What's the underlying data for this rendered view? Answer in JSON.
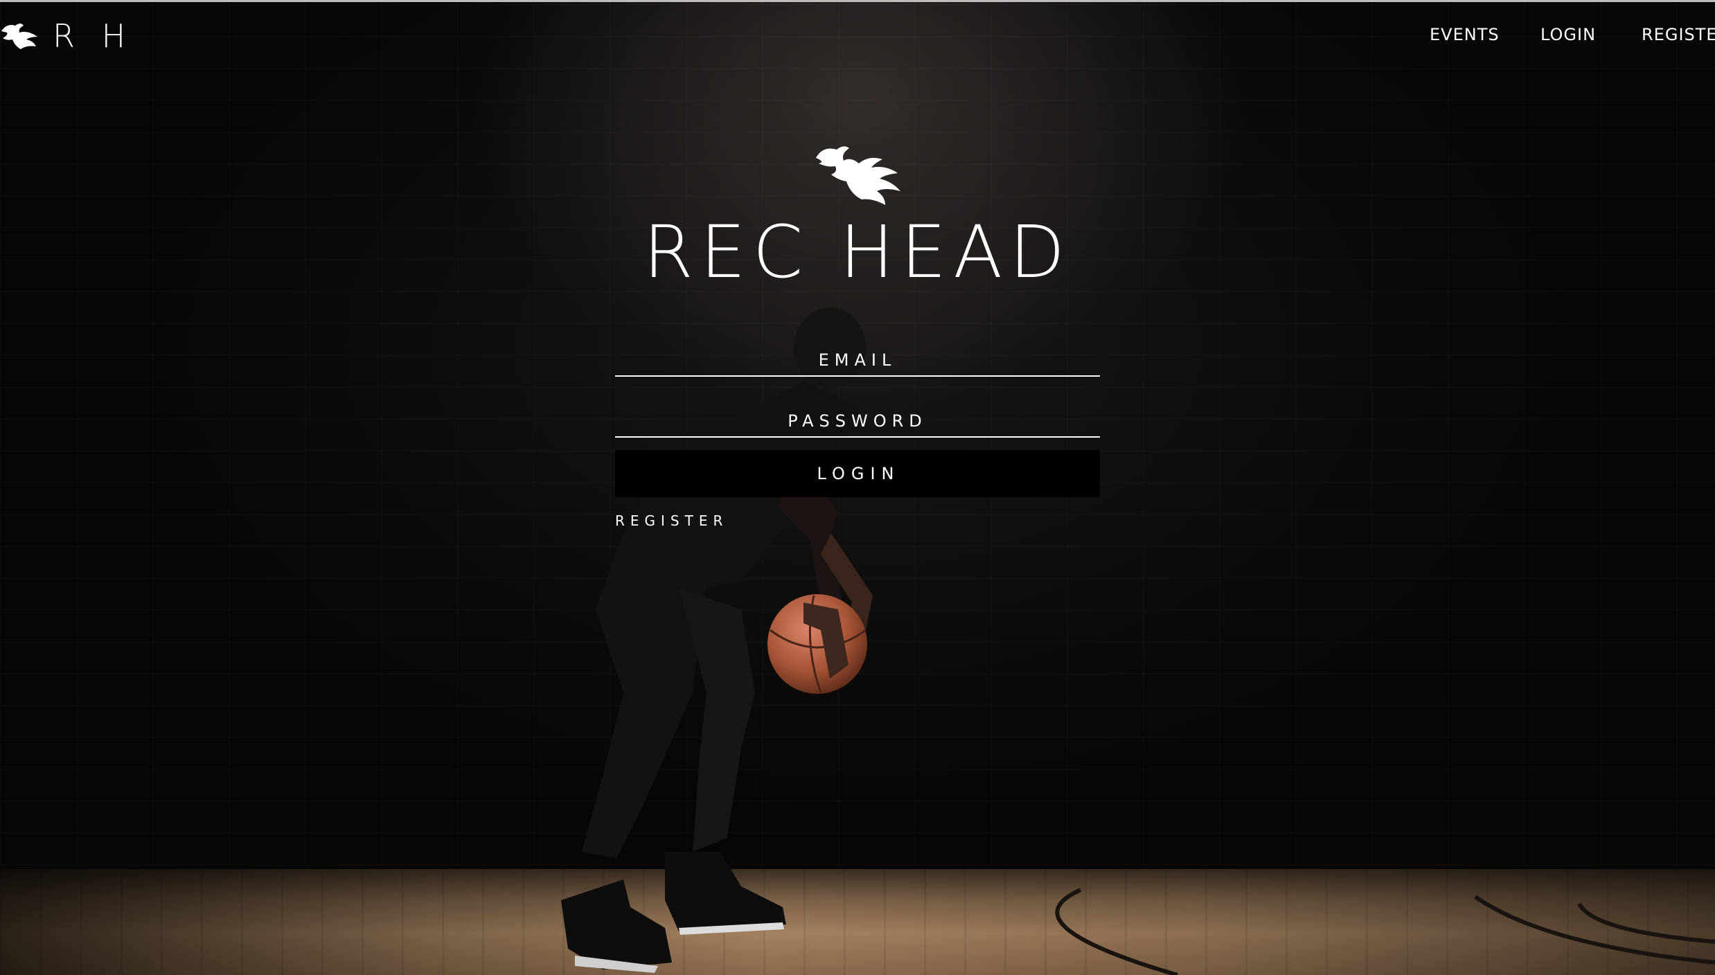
{
  "brand": {
    "initials": "R H",
    "logo_icon": "phoenix-bird-icon"
  },
  "nav": {
    "events": "EVENTS",
    "login": "LOGIN",
    "register": "REGISTER"
  },
  "hero": {
    "logo_icon": "phoenix-bird-icon",
    "title": "REC HEAD"
  },
  "form": {
    "email_placeholder": "EMAIL",
    "password_placeholder": "PASSWORD",
    "login_label": "LOGIN",
    "register_label": "REGISTER"
  },
  "colors": {
    "text": "#ffffff",
    "background": "#060606",
    "button": "#000000"
  }
}
